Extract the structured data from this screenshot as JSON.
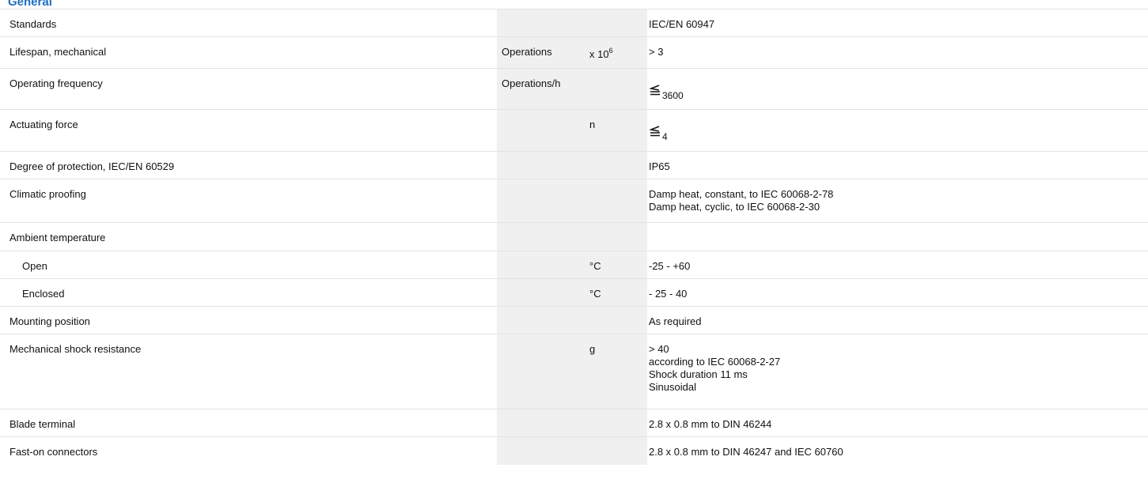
{
  "section": {
    "title": "General"
  },
  "colors": {
    "title": "#1f6fc2",
    "shaded": "#f0f0f0",
    "rule": "#e3e3e3"
  },
  "rows": [
    {
      "label": "Standards",
      "unit": "",
      "mult": "",
      "value": [
        "IEC/EN 60947"
      ]
    },
    {
      "label": "Lifespan, mechanical",
      "unit": "Operations",
      "mult": "x 10",
      "mult_exp": "6",
      "value": [
        "> 3"
      ]
    },
    {
      "label": "Operating frequency",
      "unit": "Operations/h",
      "mult": "",
      "value_symbol": "less-than-or-equal-icon",
      "value": [
        "3600"
      ]
    },
    {
      "label": "Actuating force",
      "unit": "",
      "mult": "n",
      "value_symbol": "less-than-or-equal-icon",
      "value": [
        "4"
      ]
    },
    {
      "label": "Degree of protection, IEC/EN 60529",
      "unit": "",
      "mult": "",
      "value": [
        "IP65"
      ]
    },
    {
      "label": "Climatic proofing",
      "unit": "",
      "mult": "",
      "value": [
        "Damp heat, constant, to IEC 60068-2-78",
        "Damp heat, cyclic, to IEC 60068-2-30"
      ]
    },
    {
      "label": "Ambient temperature",
      "unit": "",
      "mult": "",
      "value": []
    },
    {
      "label": "Open",
      "indent": true,
      "unit": "",
      "mult": "°C",
      "value": [
        "-25 - +60"
      ]
    },
    {
      "label": "Enclosed",
      "indent": true,
      "unit": "",
      "mult": "°C",
      "value": [
        "- 25 - 40"
      ]
    },
    {
      "label": "Mounting position",
      "unit": "",
      "mult": "",
      "value": [
        "As required"
      ]
    },
    {
      "label": "Mechanical shock resistance",
      "unit": "",
      "mult": "g",
      "value": [
        "> 40",
        "according to IEC 60068-2-27",
        "Shock duration 11 ms",
        "Sinusoidal"
      ]
    },
    {
      "label": "Blade terminal",
      "unit": "",
      "mult": "",
      "value": [
        "2.8 x 0.8 mm to DIN 46244"
      ]
    },
    {
      "label": "Fast-on connectors",
      "unit": "",
      "mult": "",
      "value": [
        "2.8 x 0.8 mm to DIN 46247 and IEC 60760"
      ]
    }
  ]
}
